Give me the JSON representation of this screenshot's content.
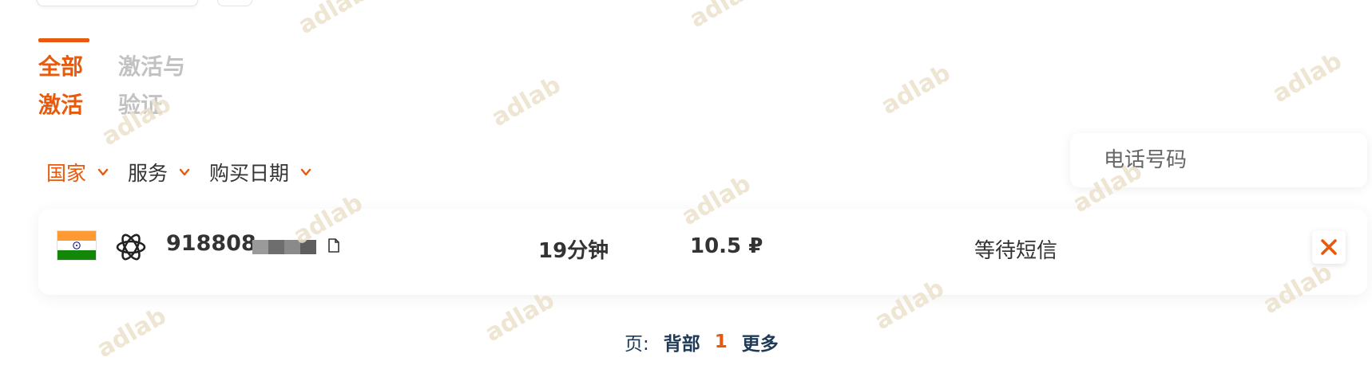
{
  "tabs": {
    "all": "全部激活",
    "activation": "激活与验证"
  },
  "filters": {
    "country": "国家",
    "service": "服务",
    "purchase_date": "购买日期"
  },
  "search": {
    "placeholder": "电话号码"
  },
  "order": {
    "country_flag": "india-flag-icon",
    "service_icon": "openai-icon",
    "phone": "918808",
    "duration": "19分钟",
    "price": "10.5 ₽",
    "status": "等待短信"
  },
  "pagination": {
    "label": "页:",
    "back": "背部",
    "current": "1",
    "more": "更多"
  },
  "watermark": "adlab",
  "colors": {
    "accent": "#e8590c",
    "link": "#1e3a56",
    "muted": "#c2c2c2"
  }
}
